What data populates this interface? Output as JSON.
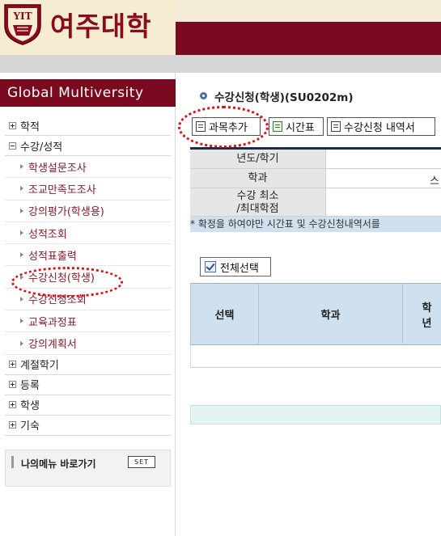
{
  "header": {
    "logo_text": "여주대학",
    "shield_text": "YIT",
    "shield_motto": "YEOJU INSTITUTE OF TECHNOLOGY"
  },
  "sidebar": {
    "title": "Global Multiversity",
    "menu": [
      {
        "label": "학적",
        "expanded": false
      },
      {
        "label": "수강/성적",
        "expanded": true,
        "children": [
          "학생설문조사",
          "조교만족도조사",
          "강의평가(학생용)",
          "성적조회",
          "성적표출력",
          "수강신청(학생)",
          "수강신청조회",
          "교육과정표",
          "강의계획서"
        ]
      },
      {
        "label": "계절학기",
        "expanded": false
      },
      {
        "label": "등록",
        "expanded": false
      },
      {
        "label": "학생",
        "expanded": false
      },
      {
        "label": "기숙",
        "expanded": false
      }
    ],
    "my_menu": {
      "label": "나의메뉴 바로가기",
      "set_label": "SET"
    }
  },
  "main": {
    "page_title": "수강신청(학생)(SU0202m)",
    "toolbar": {
      "add_course": "과목추가",
      "timetable": "시간표",
      "report": "수강신청 내역서"
    },
    "form": {
      "year_label": "년도/학기",
      "dept_label": "학과",
      "dept_value_fragment": "스",
      "credits_label_line1": "수강 최소",
      "credits_label_line2": "/최대학점"
    },
    "notice": "* 확정을 하여야만 시간표 및 수강신청내역서를",
    "select_all": "전체선택",
    "grid": {
      "col_select": "선택",
      "col_dept": "학과",
      "col_year_line1": "학",
      "col_year_line2": "년"
    }
  },
  "colors": {
    "brand_red": "#7a0a1f",
    "annotation": "#e01010",
    "header_blue": "#cfe0ee"
  }
}
